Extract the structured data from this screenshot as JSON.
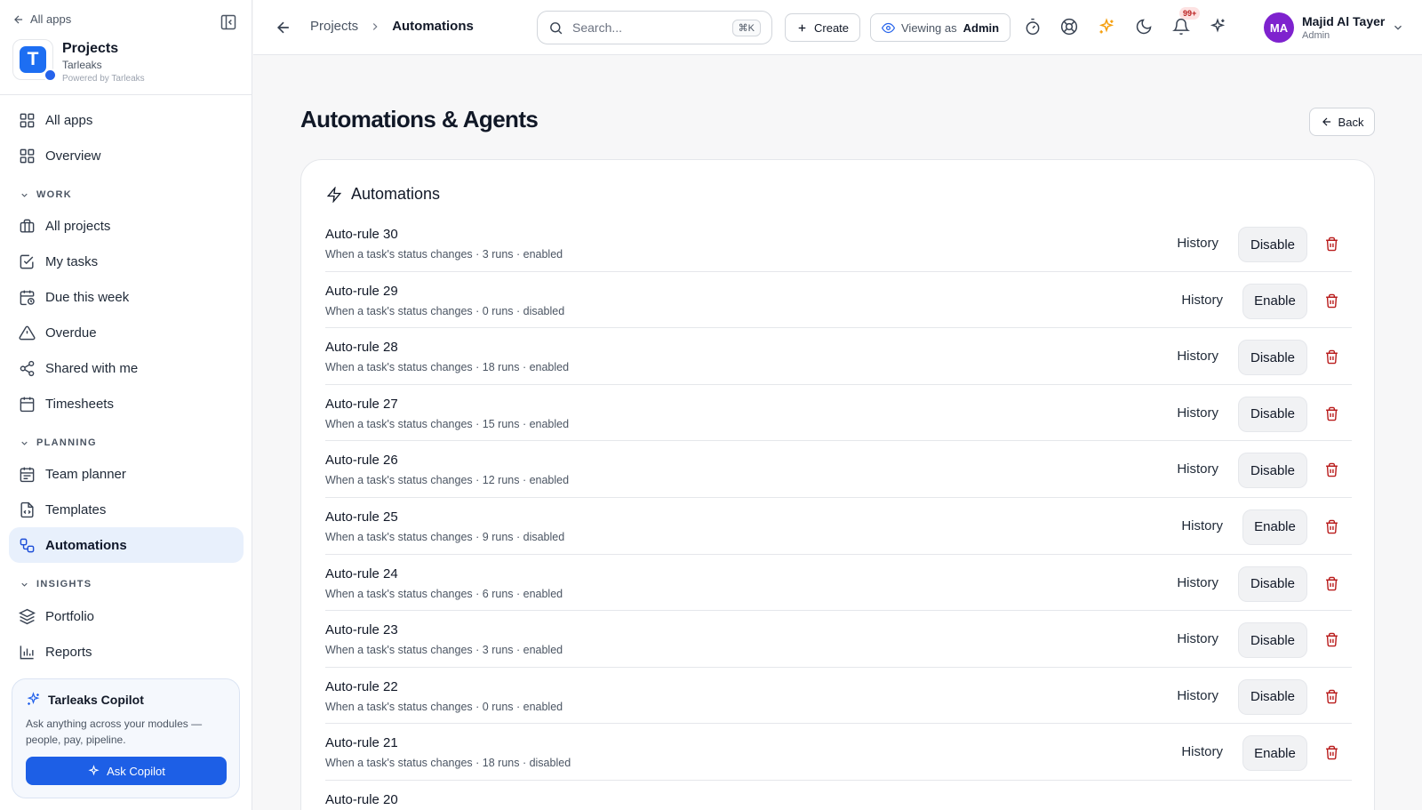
{
  "sidebar": {
    "all_apps_label": "All apps",
    "brand": {
      "letter": "T",
      "title": "Projects",
      "subtitle": "Tarleaks",
      "powered": "Powered by Tarleaks"
    },
    "nav_top": [
      {
        "label": "All apps",
        "icon": "grid-icon"
      },
      {
        "label": "Overview",
        "icon": "grid-icon"
      }
    ],
    "sections": {
      "work": "WORK",
      "planning": "PLANNING",
      "insights": "INSIGHTS"
    },
    "work_items": [
      {
        "label": "All projects",
        "icon": "briefcase-icon"
      },
      {
        "label": "My tasks",
        "icon": "check-square-icon"
      },
      {
        "label": "Due this week",
        "icon": "calendar-clock-icon"
      },
      {
        "label": "Overdue",
        "icon": "warning-icon"
      },
      {
        "label": "Shared with me",
        "icon": "share-icon"
      },
      {
        "label": "Timesheets",
        "icon": "calendar-icon"
      }
    ],
    "planning_items": [
      {
        "label": "Team planner",
        "icon": "calendar-icon"
      },
      {
        "label": "Templates",
        "icon": "file-icon"
      },
      {
        "label": "Automations",
        "icon": "workflow-icon",
        "active": true
      }
    ],
    "insights_items": [
      {
        "label": "Portfolio",
        "icon": "layers-icon"
      },
      {
        "label": "Reports",
        "icon": "bar-chart-icon"
      }
    ],
    "copilot": {
      "title": "Tarleaks Copilot",
      "description": "Ask anything across your modules — people, pay, pipeline.",
      "button": "Ask Copilot"
    }
  },
  "topbar": {
    "breadcrumb": {
      "parent": "Projects",
      "current": "Automations"
    },
    "search_placeholder": "Search...",
    "search_shortcut": "⌘K",
    "create_label": "Create",
    "viewing_as_label": "Viewing as",
    "viewing_as_role": "Admin",
    "notification_badge": "99+",
    "user": {
      "initials": "MA",
      "name": "Majid Al Tayer",
      "role": "Admin"
    },
    "colors": {
      "avatar": "#7e22ce",
      "sparkle": "#f59e0b",
      "accent": "#1d5fe6"
    }
  },
  "main": {
    "title": "Automations & Agents",
    "back_label": "Back",
    "card_title": "Automations",
    "history_label": "History",
    "rules": [
      {
        "name": "Auto-rule 30",
        "desc": "When a task's status changes · 3 runs · enabled",
        "action": "Disable"
      },
      {
        "name": "Auto-rule 29",
        "desc": "When a task's status changes · 0 runs · disabled",
        "action": "Enable"
      },
      {
        "name": "Auto-rule 28",
        "desc": "When a task's status changes · 18 runs · enabled",
        "action": "Disable"
      },
      {
        "name": "Auto-rule 27",
        "desc": "When a task's status changes · 15 runs · enabled",
        "action": "Disable"
      },
      {
        "name": "Auto-rule 26",
        "desc": "When a task's status changes · 12 runs · enabled",
        "action": "Disable"
      },
      {
        "name": "Auto-rule 25",
        "desc": "When a task's status changes · 9 runs · disabled",
        "action": "Enable"
      },
      {
        "name": "Auto-rule 24",
        "desc": "When a task's status changes · 6 runs · enabled",
        "action": "Disable"
      },
      {
        "name": "Auto-rule 23",
        "desc": "When a task's status changes · 3 runs · enabled",
        "action": "Disable"
      },
      {
        "name": "Auto-rule 22",
        "desc": "When a task's status changes · 0 runs · enabled",
        "action": "Disable"
      },
      {
        "name": "Auto-rule 21",
        "desc": "When a task's status changes · 18 runs · disabled",
        "action": "Enable"
      },
      {
        "name": "Auto-rule 20",
        "desc": "",
        "action": ""
      }
    ]
  }
}
